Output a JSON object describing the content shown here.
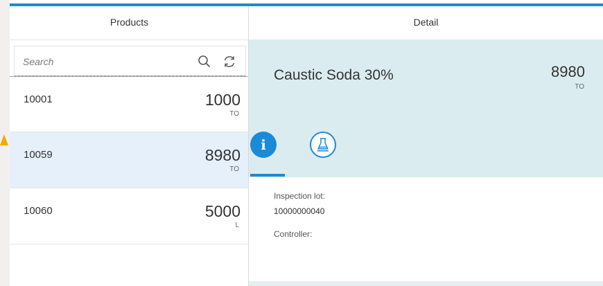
{
  "master": {
    "title": "Products",
    "search_placeholder": "Search",
    "search_icon": "search-icon",
    "refresh_icon": "refresh-icon",
    "items": [
      {
        "id": "10001",
        "quantity": "1000",
        "unit": "TO"
      },
      {
        "id": "10059",
        "quantity": "8980",
        "unit": "TO"
      },
      {
        "id": "10060",
        "quantity": "5000",
        "unit": "L"
      }
    ],
    "selected_index": 1
  },
  "detail": {
    "title": "Detail",
    "object_title": "Caustic Soda 30%",
    "number": "8980",
    "unit": "TO",
    "tabs": [
      {
        "icon": "info-icon",
        "glyph": "i",
        "selected": true
      },
      {
        "icon": "lab-flask-icon",
        "selected": false
      }
    ],
    "fields": [
      {
        "label": "Inspection lot:",
        "value": "10000000040"
      },
      {
        "label": "Controller:",
        "value": ""
      }
    ]
  },
  "colors": {
    "accent": "#1b8ad8",
    "selected_row": "#e5f0fa",
    "header_band": "#dbecf0",
    "warning_arrow": "#f0ab00"
  }
}
